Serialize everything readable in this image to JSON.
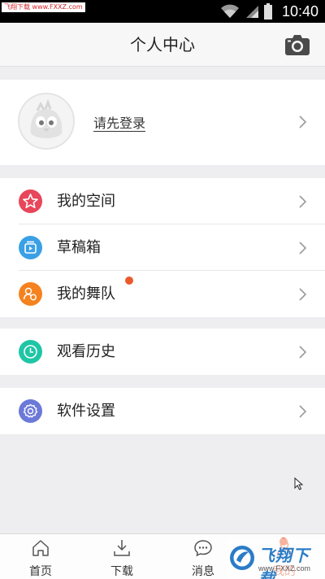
{
  "status_bar": {
    "watermark": "飞翔下载 www.FXXZ.com",
    "time": "10:40"
  },
  "header": {
    "title": "个人中心",
    "camera_icon": "camera-icon"
  },
  "profile": {
    "login_text": "请先登录",
    "avatar_icon": "bird-avatar-icon"
  },
  "menu": [
    {
      "label": "我的空间",
      "icon": "star-icon",
      "color": "#e8465a"
    },
    {
      "label": "草稿箱",
      "icon": "drafts-icon",
      "color": "#3aa0e6"
    },
    {
      "label": "我的舞队",
      "icon": "team-icon",
      "color": "#f5821f",
      "badge": true
    },
    {
      "label": "观看历史",
      "icon": "clock-icon",
      "color": "#1fc6a6"
    },
    {
      "label": "软件设置",
      "icon": "gear-icon",
      "color": "#6b79d8"
    }
  ],
  "tabbar": [
    {
      "label": "首页",
      "icon": "home-icon"
    },
    {
      "label": "下载",
      "icon": "download-icon"
    },
    {
      "label": "消息",
      "icon": "message-icon"
    },
    {
      "label": "我的",
      "icon": "user-icon",
      "badge": true
    }
  ],
  "watermark_logo": {
    "text": "飞翔下载",
    "site": "www.FXXZ.com"
  },
  "colors": {
    "badge": "#ea5a2a",
    "page_bg": "#eeeef0"
  }
}
